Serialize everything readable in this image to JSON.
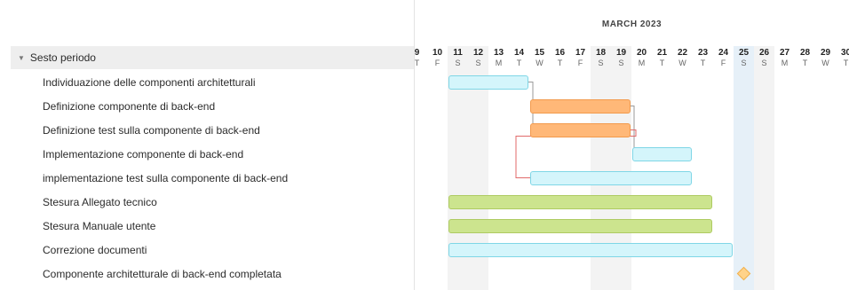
{
  "timeline": {
    "month_label": "MARCH 2023",
    "days": [
      {
        "num": "9",
        "letter": "T",
        "weekend": false
      },
      {
        "num": "10",
        "letter": "F",
        "weekend": false
      },
      {
        "num": "11",
        "letter": "S",
        "weekend": true
      },
      {
        "num": "12",
        "letter": "S",
        "weekend": true
      },
      {
        "num": "13",
        "letter": "M",
        "weekend": false
      },
      {
        "num": "14",
        "letter": "T",
        "weekend": false
      },
      {
        "num": "15",
        "letter": "W",
        "weekend": false
      },
      {
        "num": "16",
        "letter": "T",
        "weekend": false
      },
      {
        "num": "17",
        "letter": "F",
        "weekend": false
      },
      {
        "num": "18",
        "letter": "S",
        "weekend": true
      },
      {
        "num": "19",
        "letter": "S",
        "weekend": true
      },
      {
        "num": "20",
        "letter": "M",
        "weekend": false
      },
      {
        "num": "21",
        "letter": "T",
        "weekend": false
      },
      {
        "num": "22",
        "letter": "W",
        "weekend": false
      },
      {
        "num": "23",
        "letter": "T",
        "weekend": false
      },
      {
        "num": "24",
        "letter": "F",
        "weekend": false
      },
      {
        "num": "25",
        "letter": "S",
        "weekend": true,
        "today": true
      },
      {
        "num": "26",
        "letter": "S",
        "weekend": true
      },
      {
        "num": "27",
        "letter": "M",
        "weekend": false
      },
      {
        "num": "28",
        "letter": "T",
        "weekend": false
      },
      {
        "num": "29",
        "letter": "W",
        "weekend": false
      },
      {
        "num": "30",
        "letter": "T",
        "weekend": false
      }
    ]
  },
  "group": {
    "label": "Sesto periodo",
    "expanded": true
  },
  "tasks": [
    {
      "label": "Individuazione delle componenti architetturali",
      "type": "bar",
      "color": "cyan",
      "start": "11",
      "end": "14"
    },
    {
      "label": "Definizione componente di back-end",
      "type": "bar",
      "color": "orange",
      "start": "15",
      "end": "19"
    },
    {
      "label": "Definizione test sulla componente di back-end",
      "type": "bar",
      "color": "orange",
      "start": "15",
      "end": "19"
    },
    {
      "label": "Implementazione componente di back-end",
      "type": "bar",
      "color": "cyan",
      "start": "20",
      "end": "22"
    },
    {
      "label": "implementazione test sulla componente di back-end",
      "type": "bar",
      "color": "cyan",
      "start": "15",
      "end": "22"
    },
    {
      "label": "Stesura Allegato  tecnico",
      "type": "bar",
      "color": "green",
      "start": "11",
      "end": "23"
    },
    {
      "label": "Stesura Manuale utente",
      "type": "bar",
      "color": "green",
      "start": "11",
      "end": "23"
    },
    {
      "label": "Correzione  documenti",
      "type": "bar",
      "color": "cyan",
      "start": "11",
      "end": "24"
    },
    {
      "label": "Componente architetturale di back-end completata",
      "type": "milestone",
      "color": "milestone",
      "start": "25",
      "end": "25"
    }
  ],
  "colors": {
    "cyan": "#d4f5fb",
    "orange": "#ffb878",
    "green": "#cce48e",
    "milestone": "#ffd38a",
    "link_gray": "#9a9a9a",
    "link_red": "#e06a6a"
  }
}
